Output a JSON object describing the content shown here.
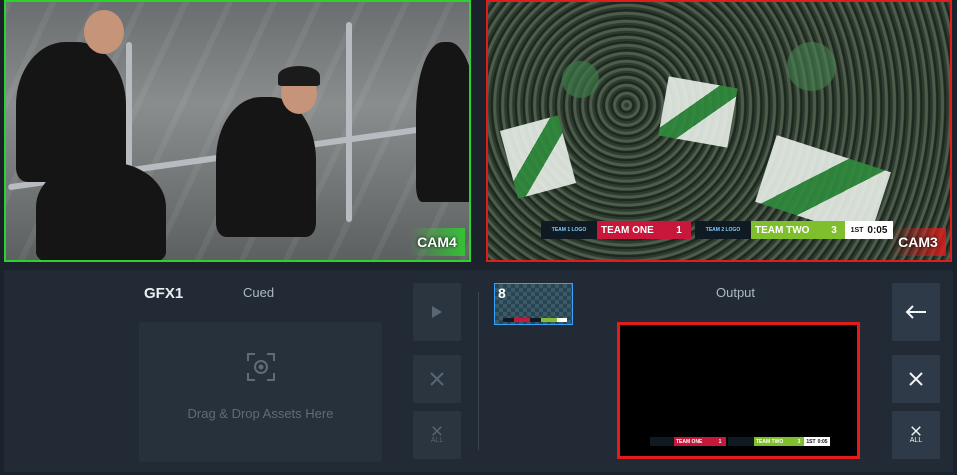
{
  "cameras": {
    "left": {
      "label": "CAM4",
      "border_color": "#2bd32b"
    },
    "right": {
      "label": "CAM3",
      "border_color": "#e21b1b"
    }
  },
  "scorebug": {
    "team1_logo": "TEAM 1 LOGO",
    "team1_name": "TEAM ONE",
    "team1_score": "1",
    "team2_logo": "TEAM 2 LOGO",
    "team2_name": "TEAM TWO",
    "team2_score": "3",
    "period": "1ST",
    "clock": "0:05",
    "team1_color": "#c7173a",
    "team2_color": "#7fbf2e"
  },
  "gfx": {
    "title": "GFX1",
    "cued_label": "Cued",
    "drop_text": "Drag & Drop Assets Here",
    "all_label": "ALL"
  },
  "asset_thumb": {
    "number": "8"
  },
  "output": {
    "label": "Output",
    "all_label": "ALL"
  },
  "icons": {
    "play": "play-icon",
    "close": "close-icon",
    "back": "arrow-left-icon",
    "drop": "focus-target-icon"
  }
}
